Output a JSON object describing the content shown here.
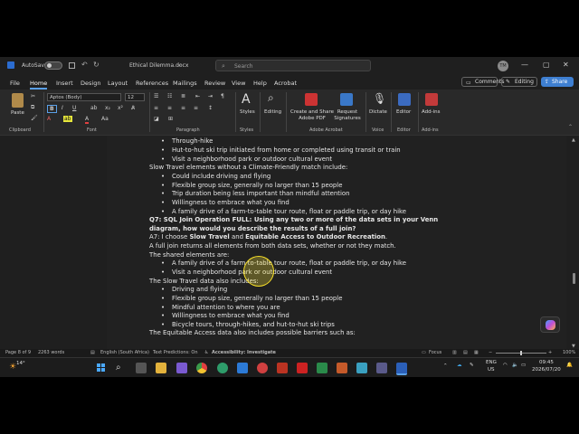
{
  "titlebar": {
    "autosave": "AutoSave",
    "doc_name": "Ethical Dilemma.docx",
    "search_placeholder": "Search",
    "avatar_initials": "TM",
    "minimize": "—",
    "maximize": "▢",
    "close": "✕"
  },
  "menu": {
    "items": [
      "File",
      "Home",
      "Insert",
      "Design",
      "Layout",
      "References",
      "Mailings",
      "Review",
      "View",
      "Help",
      "Acrobat"
    ],
    "comments": "Comments",
    "editing": "Editing",
    "share": "Share"
  },
  "ribbon": {
    "paste": "Paste",
    "clipboard": "Clipboard",
    "font_name": "Aptos (Body)",
    "font_size": "12",
    "font_group": "Font",
    "paragraph": "Paragraph",
    "styles": "Styles",
    "editing": "Editing",
    "create_share_pdf": "Create and Share Adobe PDF",
    "request_signatures": "Request Signatures",
    "adobe_acrobat": "Adobe Acrobat",
    "dictate": "Dictate",
    "voice": "Voice",
    "editor": "Editor",
    "addins": "Add-ins"
  },
  "document": {
    "lines": [
      {
        "text": "Through-hike",
        "bullet": true
      },
      {
        "text": "Hut-to-hut ski trip initiated from home or completed using transit or train",
        "bullet": true
      },
      {
        "text": "Visit a neighborhood park or outdoor cultural event",
        "bullet": true
      },
      {
        "text": "Slow Travel elements without a Climate-Friendly match include:",
        "bullet": false
      },
      {
        "text": "Could include driving and flying",
        "bullet": true
      },
      {
        "text": "Flexible group size, generally no larger than 15 people",
        "bullet": true
      },
      {
        "text": "Trip duration being less important than mindful attention",
        "bullet": true
      },
      {
        "text": "Willingness to embrace what you find",
        "bullet": true
      },
      {
        "text": "A family drive of a farm-to-table tour route, float or paddle trip, or day hike",
        "bullet": true
      },
      {
        "text": "Q7: SQL Join Operation FULL: Using any two or more of the data sets in your Venn",
        "bullet": false,
        "bold": true
      },
      {
        "text": "diagram, how would you describe the results of a full join?",
        "bullet": false,
        "bold": true
      },
      {
        "text": "A7: I choose Slow Travel and Equitable Access to Outdoor Recreation.",
        "bullet": false,
        "mixed": true
      },
      {
        "text": "A full join returns all elements from both data sets, whether or not they match.",
        "bullet": false
      },
      {
        "text": "The shared elements are:",
        "bullet": false
      },
      {
        "text": "A family drive of a farm-to-table tour route, float or paddle trip, or day hike",
        "bullet": true
      },
      {
        "text": "Visit a neighborhood park or outdoor cultural event",
        "bullet": true
      },
      {
        "text": "The Slow Travel data also includes:",
        "bullet": false
      },
      {
        "text": "Driving and flying",
        "bullet": true
      },
      {
        "text": "Flexible group size, generally no larger than 15 people",
        "bullet": true
      },
      {
        "text": "Mindful attention to where you are",
        "bullet": true
      },
      {
        "text": "Willingness to embrace what you find",
        "bullet": true
      },
      {
        "text": "Bicycle tours, through-hikes, and hut-to-hut ski trips",
        "bullet": true
      },
      {
        "text": "The Equitable Access data also includes possible barriers such as:",
        "bullet": false
      }
    ],
    "a7_prefix": "A7: I choose ",
    "a7_bold1": "Slow Travel",
    "a7_mid": " and ",
    "a7_bold2": "Equitable Access to Outdoor Recreation",
    "a7_end": "."
  },
  "status": {
    "page": "Page 8 of 9",
    "words": "2263 words",
    "language": "English (South Africa)",
    "predictions": "Text Predictions: On",
    "accessibility": "Accessibility: Investigate",
    "focus": "Focus",
    "zoom": "100%"
  },
  "taskbar": {
    "weather": "14°",
    "lang1": "ENG",
    "lang2": "US",
    "time": "09:45",
    "date": "2026/07/20"
  }
}
